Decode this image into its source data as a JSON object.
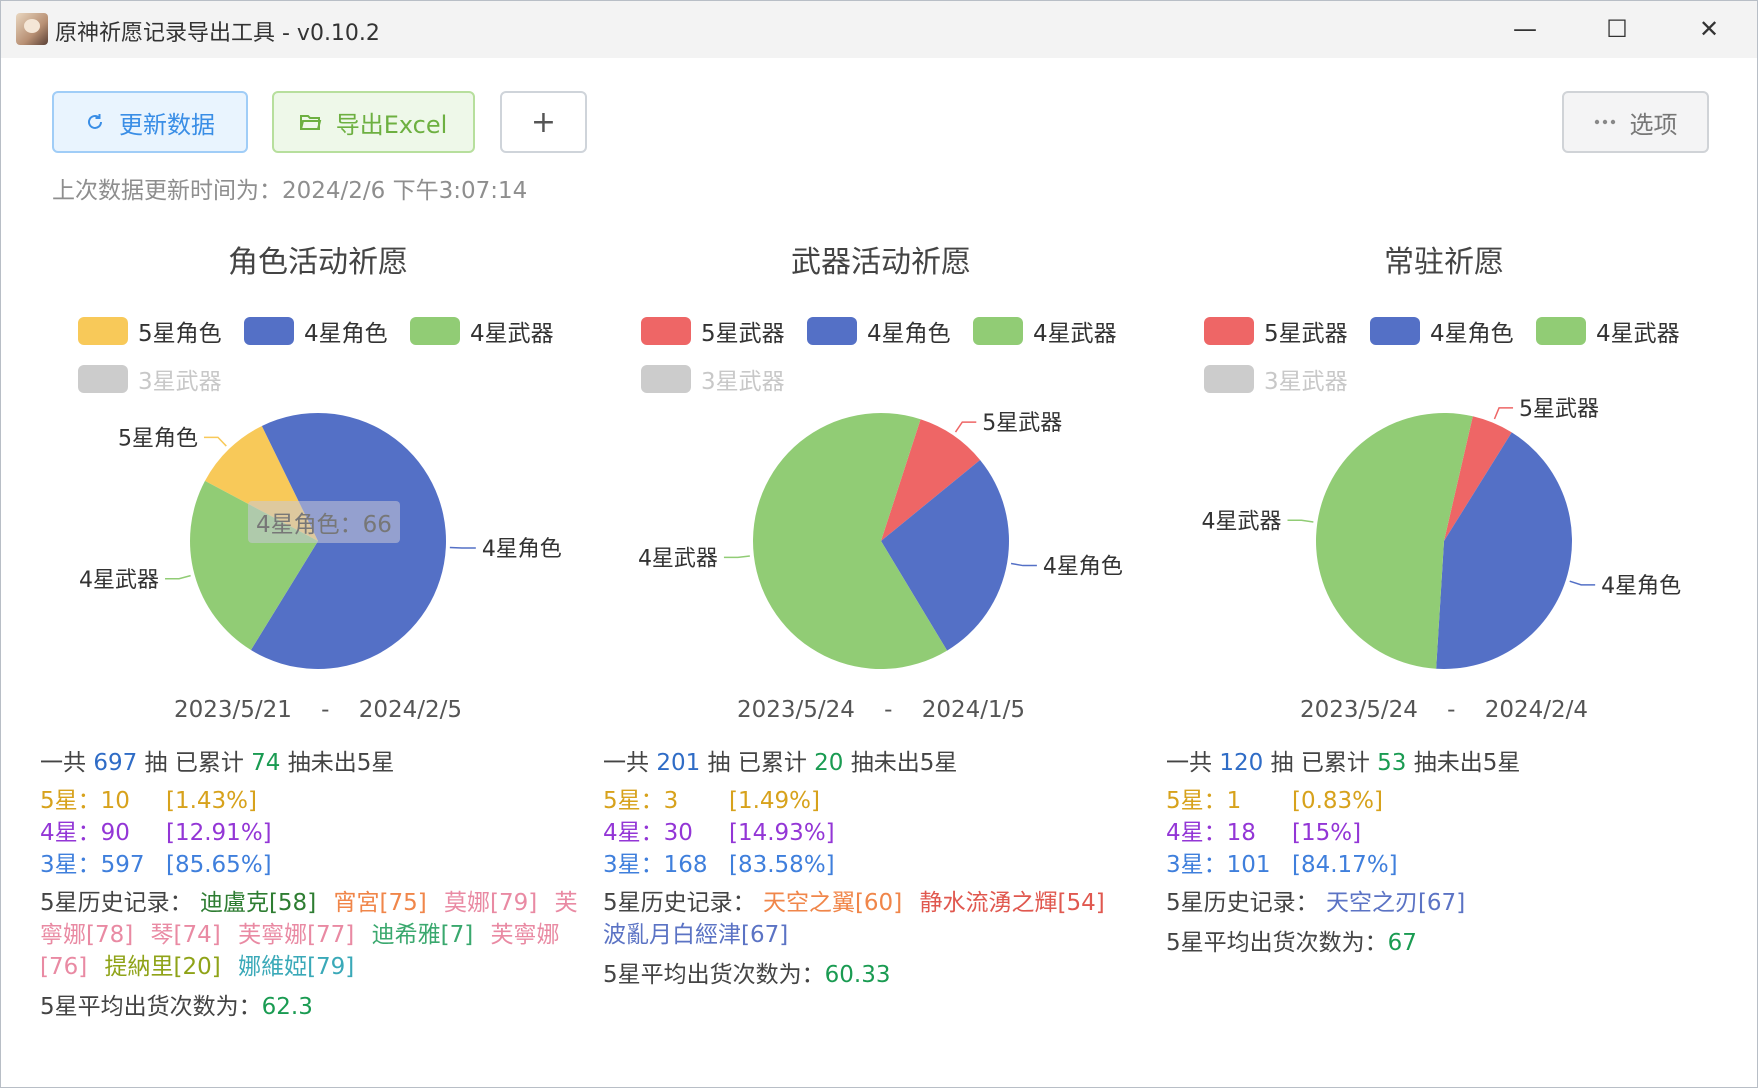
{
  "window": {
    "title": "原神祈愿记录导出工具 - v0.10.2",
    "minimize_glyph": "—",
    "maximize_glyph": "☐",
    "close_glyph": "✕"
  },
  "toolbar": {
    "refresh_label": "更新数据",
    "export_label": "导出Excel",
    "add_label": "+",
    "options_label": "选项",
    "refresh_icon": "refresh-icon",
    "export_icon": "folder-icon",
    "options_icon": "more-icon"
  },
  "update_time": "上次数据更新时间为：2024/2/6 下午3:07:14",
  "colors": {
    "five_char": "#f8c959",
    "five_weapon": "#ee6666",
    "four_char": "#5470c6",
    "four_weapon": "#91cc75",
    "three_weapon": "#cccccc"
  },
  "panels": [
    {
      "title": "角色活动祈愿",
      "legend": [
        {
          "label": "5星角色",
          "color": "#f8c959",
          "active": true
        },
        {
          "label": "4星角色",
          "color": "#5470c6",
          "active": true
        },
        {
          "label": "4星武器",
          "color": "#91cc75",
          "active": true
        },
        {
          "label": "3星武器",
          "color": "#cccccc",
          "active": false
        }
      ],
      "date_start": "2023/5/21",
      "date_sep": "-",
      "date_end": "2024/2/5",
      "total_prefix": "一共",
      "total": "697",
      "total_mid": "抽 已累计",
      "pity": "74",
      "total_suffix": "抽未出5星",
      "rates": [
        {
          "label": "5星：10",
          "pct": "[1.43%]"
        },
        {
          "label": "4星：90",
          "pct": "[12.91%]"
        },
        {
          "label": "3星：597",
          "pct": "[85.65%]"
        }
      ],
      "history_label": "5星历史记录：",
      "history": [
        {
          "text": "迪盧克[58]",
          "color": "#2e7d32"
        },
        {
          "text": "宵宮[75]",
          "color": "#f0864a"
        },
        {
          "text": "莫娜[79]",
          "color": "#e98aa3"
        },
        {
          "text": "芙寧娜[78]",
          "color": "#e98aa3"
        },
        {
          "text": "琴[74]",
          "color": "#e98aa3"
        },
        {
          "text": "芙寧娜[77]",
          "color": "#e98aa3"
        },
        {
          "text": "迪希雅[7]",
          "color": "#3aa86e"
        },
        {
          "text": "芙寧娜[76]",
          "color": "#e98aa3"
        },
        {
          "text": "提納里[20]",
          "color": "#8fa318"
        },
        {
          "text": "娜維婭[79]",
          "color": "#3aa9b8"
        }
      ],
      "avg_label": "5星平均出货次数为：",
      "avg": "62.3",
      "tooltip": "4星角色：66"
    },
    {
      "title": "武器活动祈愿",
      "legend": [
        {
          "label": "5星武器",
          "color": "#ee6666",
          "active": true
        },
        {
          "label": "4星角色",
          "color": "#5470c6",
          "active": true
        },
        {
          "label": "4星武器",
          "color": "#91cc75",
          "active": true
        },
        {
          "label": "3星武器",
          "color": "#cccccc",
          "active": false
        }
      ],
      "date_start": "2023/5/24",
      "date_sep": "-",
      "date_end": "2024/1/5",
      "total_prefix": "一共",
      "total": "201",
      "total_mid": "抽 已累计",
      "pity": "20",
      "total_suffix": "抽未出5星",
      "rates": [
        {
          "label": "5星：3",
          "pct": "[1.49%]"
        },
        {
          "label": "4星：30",
          "pct": "[14.93%]"
        },
        {
          "label": "3星：168",
          "pct": "[83.58%]"
        }
      ],
      "history_label": "5星历史记录：",
      "history": [
        {
          "text": "天空之翼[60]",
          "color": "#f0864a"
        },
        {
          "text": "静水流湧之輝[54]",
          "color": "#e0584f"
        },
        {
          "text": "波亂月白經津[67]",
          "color": "#5b73c4"
        }
      ],
      "avg_label": "5星平均出货次数为：",
      "avg": "60.33"
    },
    {
      "title": "常驻祈愿",
      "legend": [
        {
          "label": "5星武器",
          "color": "#ee6666",
          "active": true
        },
        {
          "label": "4星角色",
          "color": "#5470c6",
          "active": true
        },
        {
          "label": "4星武器",
          "color": "#91cc75",
          "active": true
        },
        {
          "label": "3星武器",
          "color": "#cccccc",
          "active": false
        }
      ],
      "date_start": "2023/5/24",
      "date_sep": "-",
      "date_end": "2024/2/4",
      "total_prefix": "一共",
      "total": "120",
      "total_mid": "抽 已累计",
      "pity": "53",
      "total_suffix": "抽未出5星",
      "rates": [
        {
          "label": "5星：1",
          "pct": "[0.83%]"
        },
        {
          "label": "4星：18",
          "pct": "[15%]"
        },
        {
          "label": "3星：101",
          "pct": "[84.17%]"
        }
      ],
      "history_label": "5星历史记录：",
      "history": [
        {
          "text": "天空之刃[67]",
          "color": "#5b73c4"
        }
      ],
      "avg_label": "5星平均出货次数为：",
      "avg": "67"
    }
  ],
  "chart_data": [
    {
      "type": "pie",
      "title": "角色活动祈愿",
      "slices": [
        {
          "name": "5星角色",
          "value": 10,
          "color": "#f8c959"
        },
        {
          "name": "4星角色",
          "value": 66,
          "color": "#5470c6"
        },
        {
          "name": "4星武器",
          "value": 24,
          "color": "#91cc75"
        }
      ],
      "legend": [
        "5星角色",
        "4星角色",
        "4星武器",
        "3星武器"
      ],
      "hidden_series": [
        "3星武器"
      ]
    },
    {
      "type": "pie",
      "title": "武器活动祈愿",
      "slices": [
        {
          "name": "5星武器",
          "value": 3,
          "color": "#ee6666"
        },
        {
          "name": "4星角色",
          "value": 9,
          "color": "#5470c6"
        },
        {
          "name": "4星武器",
          "value": 21,
          "color": "#91cc75"
        }
      ],
      "legend": [
        "5星武器",
        "4星角色",
        "4星武器",
        "3星武器"
      ],
      "hidden_series": [
        "3星武器"
      ]
    },
    {
      "type": "pie",
      "title": "常驻祈愿",
      "slices": [
        {
          "name": "5星武器",
          "value": 1,
          "color": "#ee6666"
        },
        {
          "name": "4星角色",
          "value": 8,
          "color": "#5470c6"
        },
        {
          "name": "4星武器",
          "value": 10,
          "color": "#91cc75"
        }
      ],
      "legend": [
        "5星武器",
        "4星角色",
        "4星武器",
        "3星武器"
      ],
      "hidden_series": [
        "3星武器"
      ]
    }
  ]
}
